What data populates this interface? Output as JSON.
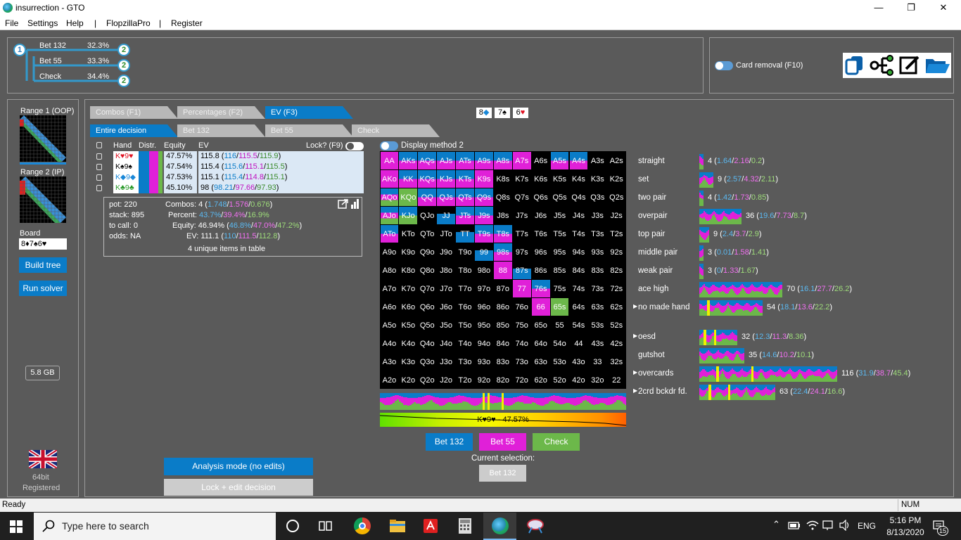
{
  "app": {
    "title": "insurrection - GTO"
  },
  "menu": [
    "File",
    "Settings",
    "Help",
    "|",
    "FlopzillaPro",
    "|",
    "Register"
  ],
  "tree": {
    "root_node": "1",
    "child_node": "2",
    "actions": [
      {
        "label": "Bet 132",
        "pct": "32.3%"
      },
      {
        "label": "Bet 55",
        "pct": "33.3%"
      },
      {
        "label": "Check",
        "pct": "34.4%"
      }
    ]
  },
  "toolbar": {
    "card_removal": "Card removal (F10)"
  },
  "left": {
    "range1": "Range 1 (OOP)",
    "range2": "Range 2 (IP)",
    "board_label": "Board",
    "board_value": "8♦7♠6♥",
    "build_tree": "Build tree",
    "run_solver": "Run solver",
    "memory": "5.8 GB",
    "bits": "64bit",
    "registered": "Registered"
  },
  "tabs_top": [
    "Combos (F1)",
    "Percentages (F2)",
    "EV (F3)"
  ],
  "tabs_decision": [
    "Entire decision",
    "Bet 132",
    "Bet 55",
    "Check"
  ],
  "board_cards": [
    {
      "rank": "8",
      "suit": "◆",
      "color": "#1a88d8"
    },
    {
      "rank": "7",
      "suit": "♠",
      "color": "#000"
    },
    {
      "rank": "6",
      "suit": "♥",
      "color": "#e01020"
    }
  ],
  "hand_table": {
    "headers": [
      "Hand",
      "Distr.",
      "Equity",
      "EV"
    ],
    "lock_label": "Lock? (F9)",
    "rows": [
      {
        "hand": "K♥9♥",
        "equity": "47.57%",
        "ev": "115.8",
        "a": "116",
        "b": "115.5",
        "c": "115.9"
      },
      {
        "hand": "K♠9♠",
        "equity": "47.54%",
        "ev": "115.4",
        "a": "115.6",
        "b": "115.1",
        "c": "115.5"
      },
      {
        "hand": "K◆9◆",
        "equity": "47.53%",
        "ev": "115.1",
        "a": "115.4",
        "b": "114.8",
        "c": "115.1"
      },
      {
        "hand": "K♣9♣",
        "equity": "45.10%",
        "ev": "98",
        "a": "98.21",
        "b": "97.66",
        "c": "97.93"
      }
    ]
  },
  "stats": {
    "pot": "pot: 220",
    "stack": "stack: 895",
    "to_call": "to call: 0",
    "odds": "odds: NA",
    "combos_label": "Combos:",
    "combos": "4",
    "combos_a": "1.748",
    "combos_b": "1.576",
    "combos_c": "0.676",
    "percent_label": "Percent:",
    "pct_a": "43.7%",
    "pct_b": "39.4%",
    "pct_c": "16.9%",
    "equity_label": "Equity:",
    "equity": "46.94%",
    "eq_a": "46.8%",
    "eq_b": "47.0%",
    "eq_c": "47.2%",
    "ev_label": "EV:",
    "ev": "111.1",
    "ev_a": "110",
    "ev_b": "111.5",
    "ev_c": "112.8",
    "unique": "4 unique items in table"
  },
  "display_method": "Display method 2",
  "grid_rows": [
    [
      "AA",
      "AKs",
      "AQs",
      "AJs",
      "ATs",
      "A9s",
      "A8s",
      "A7s",
      "A6s",
      "A5s",
      "A4s",
      "A3s",
      "A2s"
    ],
    [
      "AKo",
      "KK",
      "KQs",
      "KJs",
      "KTs",
      "K9s",
      "K8s",
      "K7s",
      "K6s",
      "K5s",
      "K4s",
      "K3s",
      "K2s"
    ],
    [
      "AQo",
      "KQo",
      "QQ",
      "QJs",
      "QTs",
      "Q9s",
      "Q8s",
      "Q7s",
      "Q6s",
      "Q5s",
      "Q4s",
      "Q3s",
      "Q2s"
    ],
    [
      "AJo",
      "KJo",
      "QJo",
      "JJ",
      "JTs",
      "J9s",
      "J8s",
      "J7s",
      "J6s",
      "J5s",
      "J4s",
      "J3s",
      "J2s"
    ],
    [
      "ATo",
      "KTo",
      "QTo",
      "JTo",
      "TT",
      "T9s",
      "T8s",
      "T7s",
      "T6s",
      "T5s",
      "T4s",
      "T3s",
      "T2s"
    ],
    [
      "A9o",
      "K9o",
      "Q9o",
      "J9o",
      "T9o",
      "99",
      "98s",
      "97s",
      "96s",
      "95s",
      "94s",
      "93s",
      "92s"
    ],
    [
      "A8o",
      "K8o",
      "Q8o",
      "J8o",
      "T8o",
      "98o",
      "88",
      "87s",
      "86s",
      "85s",
      "84s",
      "83s",
      "82s"
    ],
    [
      "A7o",
      "K7o",
      "Q7o",
      "J7o",
      "T7o",
      "97o",
      "87o",
      "77",
      "76s",
      "75s",
      "74s",
      "73s",
      "72s"
    ],
    [
      "A6o",
      "K6o",
      "Q6o",
      "J6o",
      "T6o",
      "96o",
      "86o",
      "76o",
      "66",
      "65s",
      "64s",
      "63s",
      "62s"
    ],
    [
      "A5o",
      "K5o",
      "Q5o",
      "J5o",
      "T5o",
      "95o",
      "85o",
      "75o",
      "65o",
      "55",
      "54s",
      "53s",
      "52s"
    ],
    [
      "A4o",
      "K4o",
      "Q4o",
      "J4o",
      "T4o",
      "94o",
      "84o",
      "74o",
      "64o",
      "54o",
      "44",
      "43s",
      "42s"
    ],
    [
      "A3o",
      "K3o",
      "Q3o",
      "J3o",
      "T3o",
      "93o",
      "83o",
      "73o",
      "63o",
      "53o",
      "43o",
      "33",
      "32s"
    ],
    [
      "A2o",
      "K2o",
      "Q2o",
      "J2o",
      "T2o",
      "92o",
      "82o",
      "72o",
      "62o",
      "52o",
      "42o",
      "32o",
      "22"
    ]
  ],
  "grid_fills": {
    "AA": "m",
    "AKs": "bm",
    "AQs": "bm",
    "AJs": "bm",
    "ATs": "bm",
    "A9s": "bm",
    "A8s": "bm",
    "A7s": "m",
    "A5s": "bm",
    "A4s": "bm",
    "AKo": "m",
    "KK": "bm",
    "KQs": "bm",
    "KJs": "bm",
    "KTs": "bm",
    "K9s": "m",
    "AQo": "bmg",
    "KQo": "g",
    "QQ": "bm",
    "QJs": "bm",
    "QTs": "bm",
    "Q9s": "bm",
    "AJo": "bmg",
    "KJo": "bg",
    "JJ": "b",
    "JTs": "bm",
    "J9s": "bm",
    "ATo": "bm",
    "TT": "b",
    "T9s": "bm",
    "T8s": "bm",
    "99": "b",
    "98s": "bm",
    "88": "m",
    "87s": "b",
    "77": "m",
    "76s": "bm",
    "66": "m",
    "65s": "g"
  },
  "colors": {
    "bet132": "#0a7cc8",
    "bet55": "#e020d8",
    "check": "#6cb84a",
    "yellow": "#f0f000"
  },
  "categories": [
    {
      "name": "straight",
      "count": "4",
      "a": "1.64",
      "b": "2.16",
      "c": "0.2",
      "expand": false,
      "w": 6
    },
    {
      "name": "set",
      "count": "9",
      "a": "2.57",
      "b": "4.32",
      "c": "2.11",
      "expand": false,
      "w": 20
    },
    {
      "name": "two pair",
      "count": "4",
      "a": "1.42",
      "b": "1.73",
      "c": "0.85",
      "expand": false,
      "w": 6
    },
    {
      "name": "overpair",
      "count": "36",
      "a": "19.6",
      "b": "7.73",
      "c": "8.7",
      "expand": false,
      "w": 60
    },
    {
      "name": "top pair",
      "count": "9",
      "a": "2.4",
      "b": "3.7",
      "c": "2.9",
      "expand": false,
      "w": 14
    },
    {
      "name": "middle pair",
      "count": "3",
      "a": "0.01",
      "b": "1.58",
      "c": "1.41",
      "expand": false,
      "w": 6
    },
    {
      "name": "weak pair",
      "count": "3",
      "a": "0",
      "b": "1.33",
      "c": "1.67",
      "expand": false,
      "w": 6
    },
    {
      "name": "ace high",
      "count": "70",
      "a": "16.1",
      "b": "27.7",
      "c": "26.2",
      "expand": false,
      "w": 118
    },
    {
      "name": "no made hand",
      "count": "54",
      "a": "18.1",
      "b": "13.6",
      "c": "22.2",
      "expand": true,
      "w": 90
    },
    {
      "name": "oesd",
      "count": "32",
      "a": "12.3",
      "b": "11.3",
      "c": "8.36",
      "expand": true,
      "w": 54
    },
    {
      "name": "gutshot",
      "count": "35",
      "a": "14.6",
      "b": "10.2",
      "c": "10.1",
      "expand": false,
      "w": 64
    },
    {
      "name": "overcards",
      "count": "116",
      "a": "31.9",
      "b": "38.7",
      "c": "45.4",
      "expand": true,
      "w": 196
    },
    {
      "name": "2crd bckdr fd.",
      "count": "63",
      "a": "22.4",
      "b": "24.1",
      "c": "16.6",
      "expand": true,
      "w": 108
    }
  ],
  "equity_bar_label": "K♥9♥ - 47.57%",
  "action_buttons": [
    "Bet 132",
    "Bet 55",
    "Check"
  ],
  "current_selection_label": "Current selection:",
  "current_selection": "Bet 132",
  "analysis_mode": "Analysis mode (no edits)",
  "lock_edit": "Lock + edit decision",
  "status": {
    "ready": "Ready",
    "num": "NUM"
  },
  "taskbar": {
    "search": "Type here to search",
    "lang": "ENG",
    "time": "5:16 PM",
    "date": "8/13/2020",
    "notif": "15"
  }
}
